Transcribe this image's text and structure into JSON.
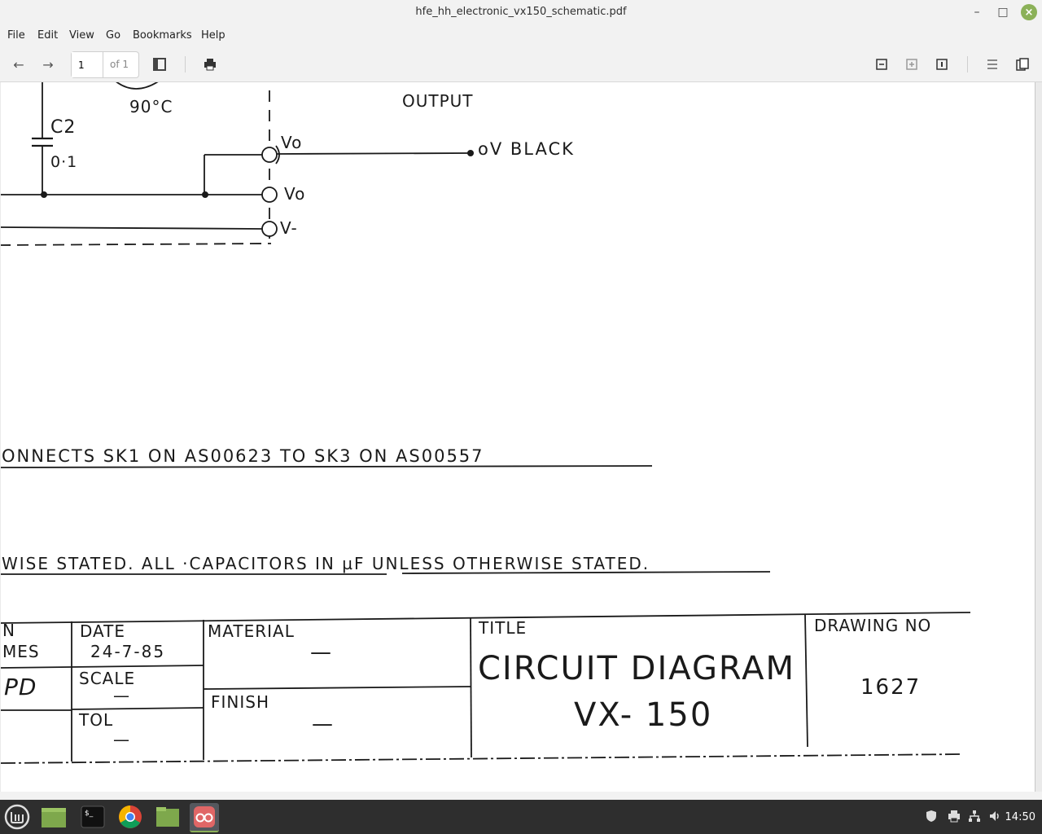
{
  "window": {
    "title": "hfe_hh_electronic_vx150_schematic.pdf"
  },
  "menu": {
    "file": "File",
    "edit": "Edit",
    "view": "View",
    "go": "Go",
    "bookmarks": "Bookmarks",
    "help": "Help"
  },
  "toolbar": {
    "page_value": "1",
    "page_total": "of 1"
  },
  "schematic": {
    "temp": "90°C",
    "output_label": "OUTPUT",
    "cap_name": "C2",
    "cap_value": "0·1",
    "vo_top": "Vo",
    "ov_black": "oV  BLACK",
    "vo_mid": "Vo",
    "v_minus": "V-",
    "connects_note": "ONNECTS   SK1   ON   AS00623   TO   SK3   ON   AS00557",
    "wise_note": "WISE    STATED.  ALL  ·CAPACITORS   IN   µF   UNLESS    OTHERWISE    STATED."
  },
  "title_block": {
    "left_top": "N",
    "left_names": "MES",
    "date_label": "DATE",
    "date_value": "24-7-85",
    "initials": "PD",
    "scale_label": "SCALE",
    "scale_value": "—",
    "tol_label": "TOL",
    "tol_value": "—",
    "material_label": "MATERIAL",
    "material_value": "—",
    "finish_label": "FINISH",
    "finish_value": "—",
    "title_label": "TITLE",
    "title_line1": "CIRCUIT   DIAGRAM",
    "title_line2": "VX-  150",
    "drawing_no_label": "DRAWING   NO",
    "drawing_no_value": "1627"
  },
  "taskbar": {
    "clock": "14:50"
  }
}
